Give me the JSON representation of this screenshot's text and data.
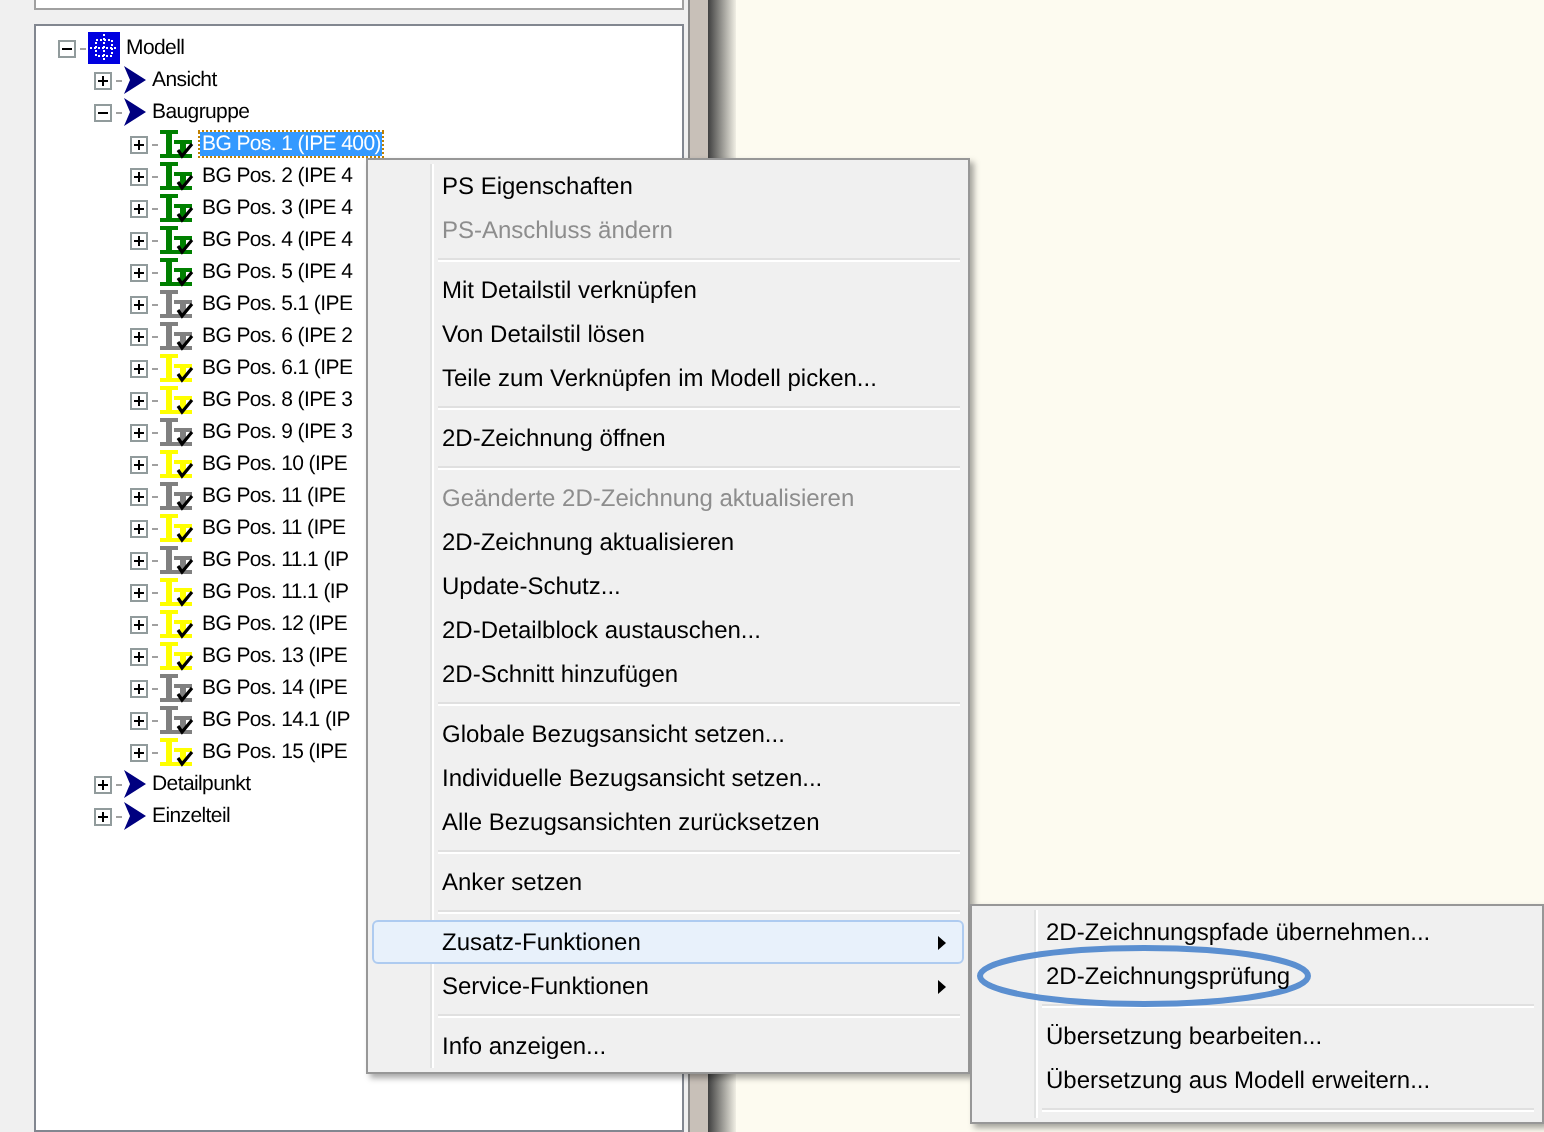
{
  "tree": [
    {
      "label": "Modell",
      "kind": "model",
      "expanded": true,
      "children": [
        {
          "label": "Ansicht",
          "kind": "arrow",
          "expanded": false
        },
        {
          "label": "Baugruppe",
          "kind": "arrow",
          "expanded": true,
          "children": [
            {
              "label": "BG Pos. 1 (IPE 400)",
              "kind": "assembly",
              "color": "#008000",
              "expanded": false,
              "selected": true
            },
            {
              "label": "BG Pos. 2 (IPE 4",
              "kind": "assembly",
              "color": "#008000",
              "expanded": false,
              "selected": false
            },
            {
              "label": "BG Pos. 3 (IPE 4",
              "kind": "assembly",
              "color": "#008000",
              "expanded": false,
              "selected": false
            },
            {
              "label": "BG Pos. 4 (IPE 4",
              "kind": "assembly",
              "color": "#008000",
              "expanded": false,
              "selected": false
            },
            {
              "label": "BG Pos. 5 (IPE 4",
              "kind": "assembly",
              "color": "#008000",
              "expanded": false,
              "selected": false
            },
            {
              "label": "BG Pos. 5.1 (IPE",
              "kind": "assembly",
              "color": "#808080",
              "expanded": false,
              "selected": false
            },
            {
              "label": "BG Pos. 6 (IPE 2",
              "kind": "assembly",
              "color": "#808080",
              "expanded": false,
              "selected": false
            },
            {
              "label": "BG Pos. 6.1 (IPE",
              "kind": "assembly",
              "color": "#ffff00",
              "expanded": false,
              "selected": false
            },
            {
              "label": "BG Pos. 8 (IPE 3",
              "kind": "assembly",
              "color": "#ffff00",
              "expanded": false,
              "selected": false
            },
            {
              "label": "BG Pos. 9 (IPE 3",
              "kind": "assembly",
              "color": "#808080",
              "expanded": false,
              "selected": false
            },
            {
              "label": "BG Pos. 10 (IPE",
              "kind": "assembly",
              "color": "#ffff00",
              "expanded": false,
              "selected": false
            },
            {
              "label": "BG Pos. 11 (IPE",
              "kind": "assembly",
              "color": "#808080",
              "expanded": false,
              "selected": false
            },
            {
              "label": "BG Pos. 11 (IPE",
              "kind": "assembly",
              "color": "#ffff00",
              "expanded": false,
              "selected": false
            },
            {
              "label": "BG Pos. 11.1 (IP",
              "kind": "assembly",
              "color": "#808080",
              "expanded": false,
              "selected": false
            },
            {
              "label": "BG Pos. 11.1 (IP",
              "kind": "assembly",
              "color": "#ffff00",
              "expanded": false,
              "selected": false
            },
            {
              "label": "BG Pos. 12 (IPE",
              "kind": "assembly",
              "color": "#ffff00",
              "expanded": false,
              "selected": false
            },
            {
              "label": "BG Pos. 13 (IPE",
              "kind": "assembly",
              "color": "#ffff00",
              "expanded": false,
              "selected": false
            },
            {
              "label": "BG Pos. 14 (IPE",
              "kind": "assembly",
              "color": "#808080",
              "expanded": false,
              "selected": false
            },
            {
              "label": "BG Pos. 14.1 (IP",
              "kind": "assembly",
              "color": "#808080",
              "expanded": false,
              "selected": false
            },
            {
              "label": "BG Pos. 15 (IPE",
              "kind": "assembly",
              "color": "#ffff00",
              "expanded": false,
              "selected": false
            }
          ]
        },
        {
          "label": "Detailpunkt",
          "kind": "arrow",
          "expanded": false
        },
        {
          "label": "Einzelteil",
          "kind": "arrow",
          "expanded": false
        }
      ]
    }
  ],
  "context_menu": {
    "items": [
      {
        "kind": "item",
        "label": "PS Eigenschaften",
        "disabled": false,
        "selected": false
      },
      {
        "kind": "item",
        "label": "PS-Anschluss ändern",
        "disabled": true,
        "selected": false
      },
      {
        "kind": "separator"
      },
      {
        "kind": "item",
        "label": "Mit Detailstil verknüpfen",
        "disabled": false,
        "selected": false
      },
      {
        "kind": "item",
        "label": "Von Detailstil lösen",
        "disabled": false,
        "selected": false
      },
      {
        "kind": "item",
        "label": "Teile zum Verknüpfen im Modell picken...",
        "disabled": false,
        "selected": false
      },
      {
        "kind": "separator"
      },
      {
        "kind": "item",
        "label": "2D-Zeichnung öffnen",
        "disabled": false,
        "selected": false
      },
      {
        "kind": "separator"
      },
      {
        "kind": "item",
        "label": "Geänderte 2D-Zeichnung aktualisieren",
        "disabled": true,
        "selected": false
      },
      {
        "kind": "item",
        "label": "2D-Zeichnung aktualisieren",
        "disabled": false,
        "selected": false
      },
      {
        "kind": "item",
        "label": "Update-Schutz...",
        "disabled": false,
        "selected": false
      },
      {
        "kind": "item",
        "label": "2D-Detailblock austauschen...",
        "disabled": false,
        "selected": false
      },
      {
        "kind": "item",
        "label": "2D-Schnitt hinzufügen",
        "disabled": false,
        "selected": false
      },
      {
        "kind": "separator"
      },
      {
        "kind": "item",
        "label": "Globale Bezugsansicht setzen...",
        "disabled": false,
        "selected": false
      },
      {
        "kind": "item",
        "label": "Individuelle Bezugsansicht setzen...",
        "disabled": false,
        "selected": false
      },
      {
        "kind": "item",
        "label": "Alle Bezugsansichten zurücksetzen",
        "disabled": false,
        "selected": false
      },
      {
        "kind": "separator"
      },
      {
        "kind": "item",
        "label": "Anker setzen",
        "disabled": false,
        "selected": false
      },
      {
        "kind": "separator"
      },
      {
        "kind": "submenu",
        "label": "Zusatz-Funktionen",
        "disabled": false,
        "selected": true
      },
      {
        "kind": "submenu",
        "label": "Service-Funktionen",
        "disabled": false,
        "selected": false
      },
      {
        "kind": "separator"
      },
      {
        "kind": "item",
        "label": "Info anzeigen...",
        "disabled": false,
        "selected": false
      }
    ]
  },
  "submenu": {
    "items": [
      {
        "kind": "item",
        "label": "2D-Zeichnungspfade übernehmen...",
        "disabled": false,
        "selected": false
      },
      {
        "kind": "item",
        "label": "2D-Zeichnungsprüfung",
        "disabled": false,
        "selected": false,
        "circled": true
      },
      {
        "kind": "separator"
      },
      {
        "kind": "item",
        "label": "Übersetzung bearbeiten...",
        "disabled": false,
        "selected": false
      },
      {
        "kind": "item",
        "label": "Übersetzung aus Modell erweitern...",
        "disabled": false,
        "selected": false
      },
      {
        "kind": "separator"
      }
    ]
  }
}
